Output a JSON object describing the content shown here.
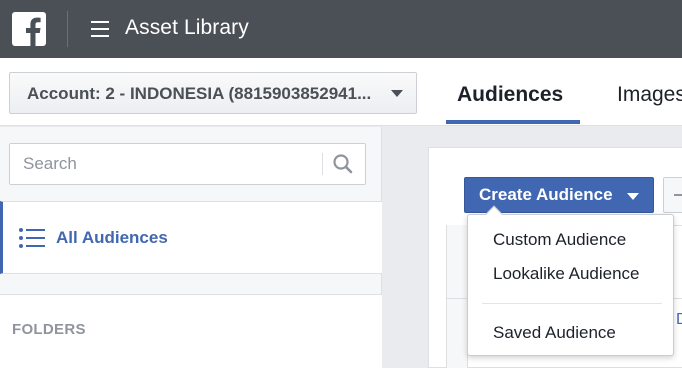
{
  "topbar": {
    "app_title": "Asset Library",
    "bg_color": "#4b4f56"
  },
  "account": {
    "selected": "Account: 2 - INDONESIA (8815903852941..."
  },
  "tabs": [
    {
      "label": "Audiences",
      "active": true
    },
    {
      "label": "Images",
      "active": false
    }
  ],
  "sidebar": {
    "search_placeholder": "Search",
    "all_audiences_label": "All Audiences",
    "folders_title": "FOLDERS"
  },
  "main": {
    "create_button_label": "Create Audience",
    "peek_text": "D"
  },
  "dropdown": {
    "items": [
      {
        "label": "Custom Audience"
      },
      {
        "label": "Lookalike Audience"
      },
      {
        "label": "Saved Audience"
      }
    ]
  },
  "colors": {
    "accent": "#4267b2",
    "topbar": "#4b4f56",
    "muted_text": "#90949c"
  },
  "icons": [
    "facebook-logo-icon",
    "hamburger-menu-icon",
    "search-icon",
    "list-icon",
    "chevron-down-icon"
  ]
}
